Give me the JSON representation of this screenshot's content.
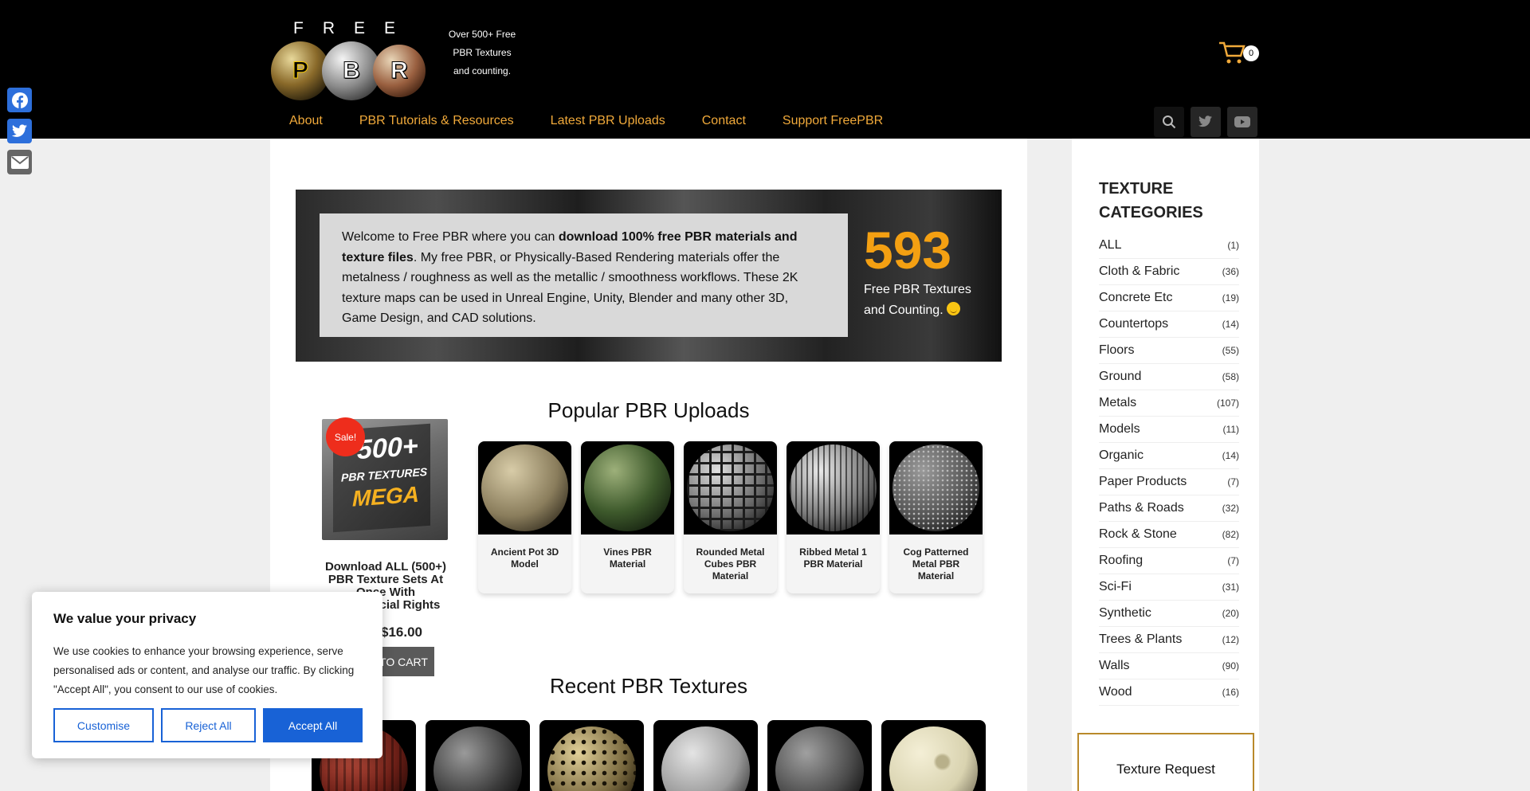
{
  "header": {
    "logo_letters": [
      "F",
      "R",
      "E",
      "E"
    ],
    "logo_balls": [
      "P",
      "B",
      "R"
    ],
    "tagline": [
      "Over 500+ Free",
      "PBR Textures",
      "and counting."
    ],
    "cart_count": "0",
    "nav": [
      "About",
      "PBR Tutorials & Resources",
      "Latest PBR Uploads",
      "Contact",
      "Support FreePBR"
    ],
    "nav_icons": [
      "search-icon",
      "twitter-icon",
      "youtube-icon"
    ]
  },
  "social": [
    "facebook-icon",
    "twitter-icon",
    "email-icon"
  ],
  "hero": {
    "intro_1": "Welcome to Free PBR where you can ",
    "intro_bold": "download 100% free PBR materials and texture files",
    "intro_2": ".  My free PBR, or Physically-Based Rendering materials offer the metalness / roughness as well as the metallic / smoothness workflows.  These 2K texture maps can be used in Unreal Engine, Unity, Blender and many other 3D, Game Design, and CAD solutions.",
    "count": "593",
    "count_sub": "Free PBR Textures and Counting."
  },
  "product": {
    "sale_badge": "Sale!",
    "box_line1": "500+",
    "box_line2": "PBR TEXTURES",
    "box_line3": "MEGA",
    "title": "Download ALL (500+) PBR Texture Sets At Once With Commercial Rights",
    "price": "$16.00",
    "add_to_cart": "TO CART"
  },
  "popular": {
    "title": "Popular PBR Uploads",
    "items": [
      {
        "title": "Ancient Pot 3D Model",
        "color": "#8a7d5c"
      },
      {
        "title": "Vines PBR Material",
        "color": "#3e5a2c"
      },
      {
        "title": "Rounded Metal Cubes PBR Material",
        "color": "#6b6b6b"
      },
      {
        "title": "Ribbed Metal 1 PBR Material",
        "color": "#7a7a7a"
      },
      {
        "title": "Cog Patterned Metal PBR Material",
        "color": "#555555"
      }
    ]
  },
  "recent": {
    "title": "Recent PBR Textures",
    "colors": [
      "#6a1e16",
      "#3a3a3a",
      "#7a6a40",
      "#9a9a9a",
      "#4a4a4a",
      "#d9d3b0"
    ]
  },
  "sidebar": {
    "title": "TEXTURE CATEGORIES",
    "categories": [
      {
        "name": "ALL",
        "count": "(1)"
      },
      {
        "name": "Cloth & Fabric",
        "count": "(36)"
      },
      {
        "name": "Concrete Etc",
        "count": "(19)"
      },
      {
        "name": "Countertops",
        "count": "(14)"
      },
      {
        "name": "Floors",
        "count": "(55)"
      },
      {
        "name": "Ground",
        "count": "(58)"
      },
      {
        "name": "Metals",
        "count": "(107)"
      },
      {
        "name": "Models",
        "count": "(11)"
      },
      {
        "name": "Organic",
        "count": "(14)"
      },
      {
        "name": "Paper Products",
        "count": "(7)"
      },
      {
        "name": "Paths & Roads",
        "count": "(32)"
      },
      {
        "name": "Rock & Stone",
        "count": "(82)"
      },
      {
        "name": "Roofing",
        "count": "(7)"
      },
      {
        "name": "Sci-Fi",
        "count": "(31)"
      },
      {
        "name": "Synthetic",
        "count": "(20)"
      },
      {
        "name": "Trees & Plants",
        "count": "(12)"
      },
      {
        "name": "Walls",
        "count": "(90)"
      },
      {
        "name": "Wood",
        "count": "(16)"
      }
    ],
    "texture_request": "Texture Request"
  },
  "cookie": {
    "title": "We value your privacy",
    "body": "We use cookies to enhance your browsing experience, serve personalised ads or content, and analyse our traffic. By clicking \"Accept All\", you consent to our use of cookies.",
    "customise": "Customise",
    "reject": "Reject All",
    "accept": "Accept All"
  },
  "colors": {
    "accent": "#f0a93a",
    "count": "#f4a012",
    "cookie_blue": "#1862d6",
    "sale": "#ee2d1c"
  }
}
